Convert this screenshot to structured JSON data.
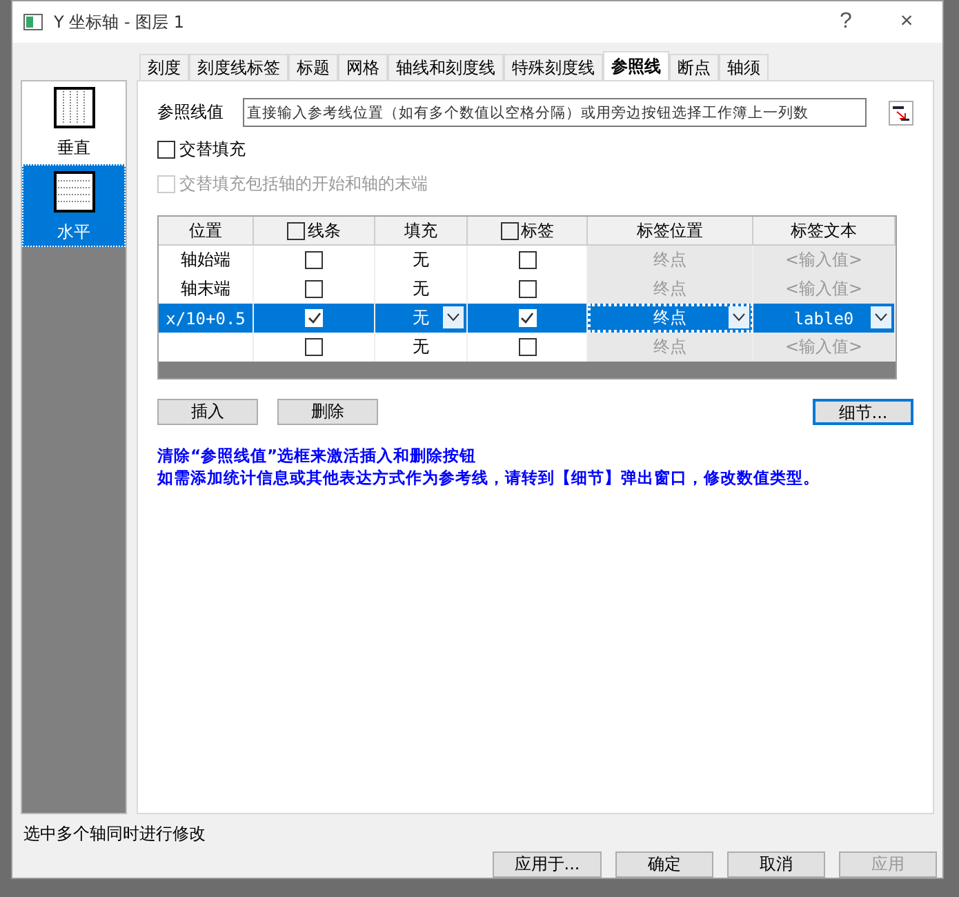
{
  "window": {
    "title": "Y 坐标轴 - 图层 1",
    "help": "?",
    "close": "×"
  },
  "tabs": [
    {
      "label": "刻度",
      "selected": false
    },
    {
      "label": "刻度线标签",
      "selected": false
    },
    {
      "label": "标题",
      "selected": false
    },
    {
      "label": "网格",
      "selected": false
    },
    {
      "label": "轴线和刻度线",
      "selected": false
    },
    {
      "label": "特殊刻度线",
      "selected": false
    },
    {
      "label": "参照线",
      "selected": true
    },
    {
      "label": "断点",
      "selected": false
    },
    {
      "label": "轴须",
      "selected": false
    }
  ],
  "sidebar": {
    "items": [
      {
        "label": "垂直",
        "kind": "vertical",
        "selected": false
      },
      {
        "label": "水平",
        "kind": "horizontal",
        "selected": true
      }
    ]
  },
  "reference_values": {
    "label": "参照线值",
    "value": "直接输入参考线位置（如有多个数值以空格分隔）或用旁边按钮选择工作簿上一列数"
  },
  "options": [
    {
      "label": "交替填充",
      "checked": false,
      "disabled": false
    },
    {
      "label": "交替填充包括轴的开始和轴的末端",
      "checked": false,
      "disabled": true
    }
  ],
  "table": {
    "columns": [
      {
        "label": "位置",
        "kind": "text"
      },
      {
        "label": "线条",
        "kind": "checkbox",
        "checked": false
      },
      {
        "label": "填充",
        "kind": "text"
      },
      {
        "label": "标签",
        "kind": "checkbox",
        "checked": false
      },
      {
        "label": "标签位置",
        "kind": "text"
      },
      {
        "label": "标签文本",
        "kind": "text"
      }
    ],
    "rows": [
      {
        "position": "轴始端",
        "line": false,
        "fill": "无",
        "label": false,
        "label_position": "终点",
        "label_text": "<输入值>",
        "selected": false
      },
      {
        "position": "轴末端",
        "line": false,
        "fill": "无",
        "label": false,
        "label_position": "终点",
        "label_text": "<输入值>",
        "selected": false
      },
      {
        "position": "x/10+0.5",
        "line": true,
        "fill": "无",
        "label": true,
        "label_position": "终点",
        "label_text": "lable0",
        "selected": true
      },
      {
        "line": false,
        "fill": "无",
        "label": false,
        "label_position": "终点",
        "label_text": "<输入值>",
        "selected": false
      }
    ]
  },
  "row_buttons": [
    {
      "label": "插入",
      "focused": false
    },
    {
      "label": "删除",
      "focused": false
    }
  ],
  "details_button": {
    "label": "细节...",
    "focused": true
  },
  "notes": [
    "清除“参照线值”选框来激活插入和删除按钮",
    "如需添加统计信息或其他表达方式作为参考线，请转到【细节】弹出窗口，修改数值类型。"
  ],
  "status": "选中多个轴同时进行修改",
  "footer_buttons": [
    {
      "label": "应用于...",
      "disabled": false
    },
    {
      "label": "确定",
      "disabled": false
    },
    {
      "label": "取消",
      "disabled": false
    },
    {
      "label": "应用",
      "disabled": true
    }
  ]
}
